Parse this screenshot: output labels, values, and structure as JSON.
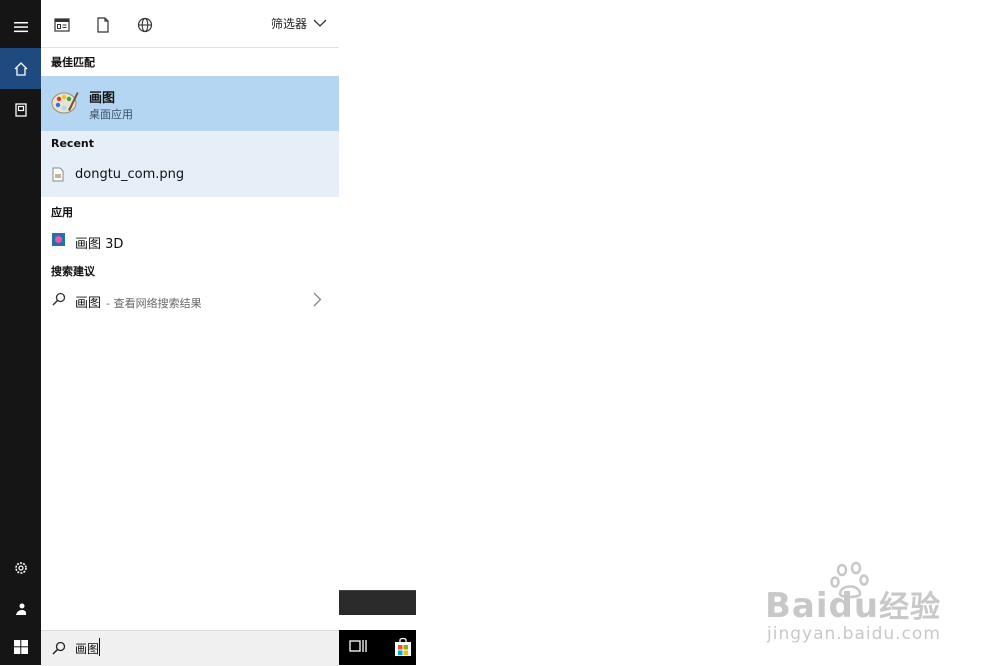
{
  "rail": {
    "items": [
      "menu-icon",
      "home-icon",
      "document-collection-icon",
      "settings-icon",
      "user-icon",
      "windows-start-icon"
    ]
  },
  "panel": {
    "top_icons": [
      "apps-icon",
      "document-icon",
      "web-globe-icon"
    ],
    "filter_label": "筛选器"
  },
  "results": {
    "best_match_heading": "最佳匹配",
    "best_match": {
      "title": "画图",
      "subtitle": "桌面应用"
    },
    "recent_heading": "Recent",
    "recent_items": [
      {
        "label": "dongtu_com.png"
      }
    ],
    "apps_heading": "应用",
    "apps": [
      {
        "label": "画图 3D"
      }
    ],
    "suggest_heading": "搜索建议",
    "suggestions": [
      {
        "label": "画图",
        "detail": "- 查看网络搜索结果"
      }
    ]
  },
  "search": {
    "value": "画图"
  },
  "watermark": {
    "brand": "Baidu",
    "brand_cn": "经验",
    "url": "jingyan.baidu.com"
  },
  "colors": {
    "rail": "#151515",
    "active": "#1f4a80",
    "best_match_bg": "#b5d6f2",
    "recent_bg": "#e6eff8"
  }
}
